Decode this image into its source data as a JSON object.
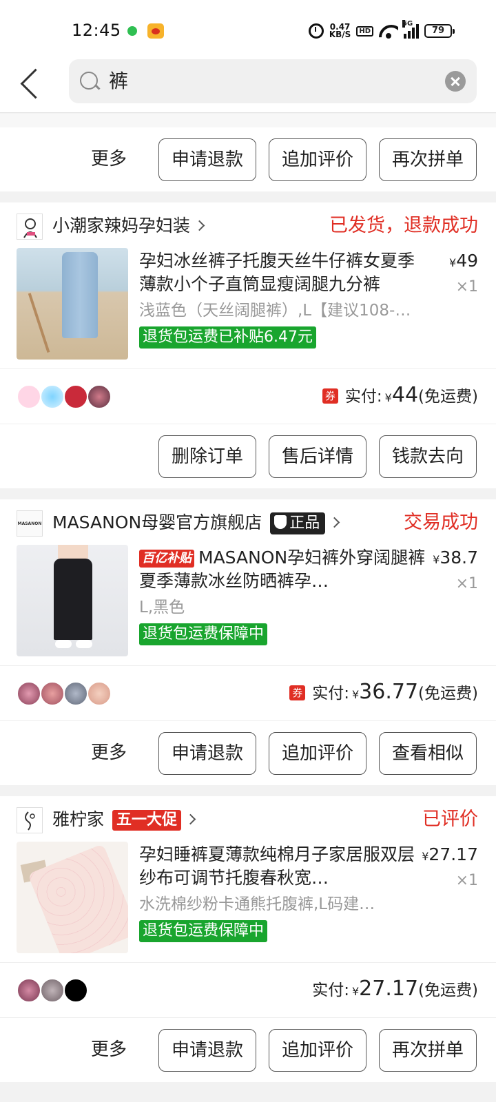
{
  "status_bar": {
    "time": "12:45",
    "net_speed_value": "0.47",
    "net_speed_unit": "KB/S",
    "hd": "HD",
    "network": "5G",
    "battery": "79"
  },
  "search": {
    "query": "裤"
  },
  "top_actions": {
    "more": "更多",
    "buttons": [
      "申请退款",
      "追加评价",
      "再次拼单"
    ]
  },
  "orders": [
    {
      "shop": "小潮家辣妈孕妇装",
      "status": "已发货，退款成功",
      "title": "孕妇冰丝裤子托腹天丝牛仔裤女夏季薄款小个子直筒显瘦阔腿九分裤",
      "spec": "浅蓝色（天丝阔腿裤）,L【建议108-…",
      "tag": "退货包运费已补贴6.47元",
      "price": "49",
      "qty": "×1",
      "coupon": "券",
      "paid_label": "实付:",
      "paid_amount": "44",
      "shipping": "(免运费)",
      "buttons": [
        "删除订单",
        "售后详情",
        "钱款去向"
      ]
    },
    {
      "shop": "MASANON母婴官方旗舰店",
      "shop_logo_text": "MASANON",
      "badge": "正品",
      "status": "交易成功",
      "subsidy_badge": "百亿补贴",
      "title": "MASANON孕妇裤外穿阔腿裤夏季薄款冰丝防晒裤孕…",
      "spec": "L,黑色",
      "tag": "退货包运费保障中",
      "price": "38.7",
      "qty": "×1",
      "coupon": "券",
      "paid_label": "实付:",
      "paid_amount": "36.77",
      "shipping": "(免运费)",
      "more": "更多",
      "buttons": [
        "申请退款",
        "追加评价",
        "查看相似"
      ]
    },
    {
      "shop": "雅柠家",
      "promo_badge": "五一大促",
      "status": "已评价",
      "title": "孕妇睡裤夏薄款纯棉月子家居服双层纱布可调节托腹春秋宽…",
      "spec": "水洗棉纱粉卡通熊托腹裤,L码建…",
      "tag": "退货包运费保障中",
      "price": "27.17",
      "qty": "×1",
      "paid_label": "实付:",
      "paid_amount": "27.17",
      "shipping": "(免运费)",
      "more": "更多",
      "buttons": [
        "申请退款",
        "追加评价",
        "再次拼单"
      ]
    }
  ],
  "currency": "¥",
  "colors": {
    "accent_red": "#e02e24",
    "tag_green": "#19a52e"
  }
}
